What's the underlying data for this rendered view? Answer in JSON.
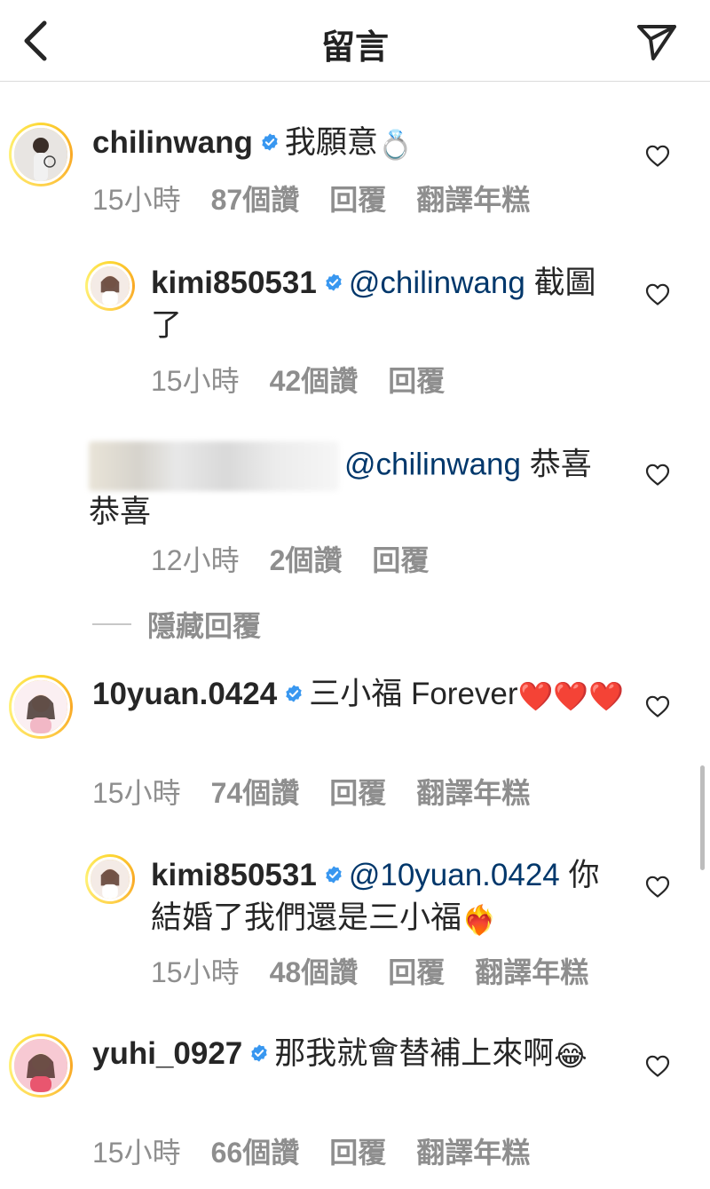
{
  "header": {
    "title": "留言"
  },
  "comments": [
    {
      "username": "chilinwang",
      "text": "我願意",
      "emoji": "💍",
      "time": "15小時",
      "likes": "87個讚",
      "reply": "回覆",
      "translate": "翻譯年糕"
    },
    {
      "username": "kimi850531",
      "mention": "@chilinwang",
      "text": "截圖了",
      "time": "15小時",
      "likes": "42個讚",
      "reply": "回覆"
    },
    {
      "mention": "@chilinwang",
      "text": "恭喜恭喜",
      "time": "12小時",
      "likes": "2個讚",
      "reply": "回覆"
    },
    {
      "username": "10yuan.0424",
      "text": "三小福 Forever",
      "emoji": "❤️❤️❤️",
      "time": "15小時",
      "likes": "74個讚",
      "reply": "回覆",
      "translate": "翻譯年糕"
    },
    {
      "username": "kimi850531",
      "mention": "@10yuan.0424",
      "text": "你結婚了我們還是三小福",
      "emoji": "❤️‍🔥",
      "time": "15小時",
      "likes": "48個讚",
      "reply": "回覆",
      "translate": "翻譯年糕"
    },
    {
      "username": "yuhi_0927",
      "text": "那我就會替補上來啊",
      "emoji": "😂",
      "time": "15小時",
      "likes": "66個讚",
      "reply": "回覆",
      "translate": "翻譯年糕"
    }
  ],
  "hidden_replies": "隱藏回覆",
  "colors": {
    "mention": "#00376b",
    "verified": "#3897f0",
    "meta": "#8e8e8e"
  },
  "icons": {
    "back": "chevron-left-icon",
    "send": "paper-plane-icon",
    "like": "heart-outline-icon",
    "verified": "verified-badge-icon"
  }
}
